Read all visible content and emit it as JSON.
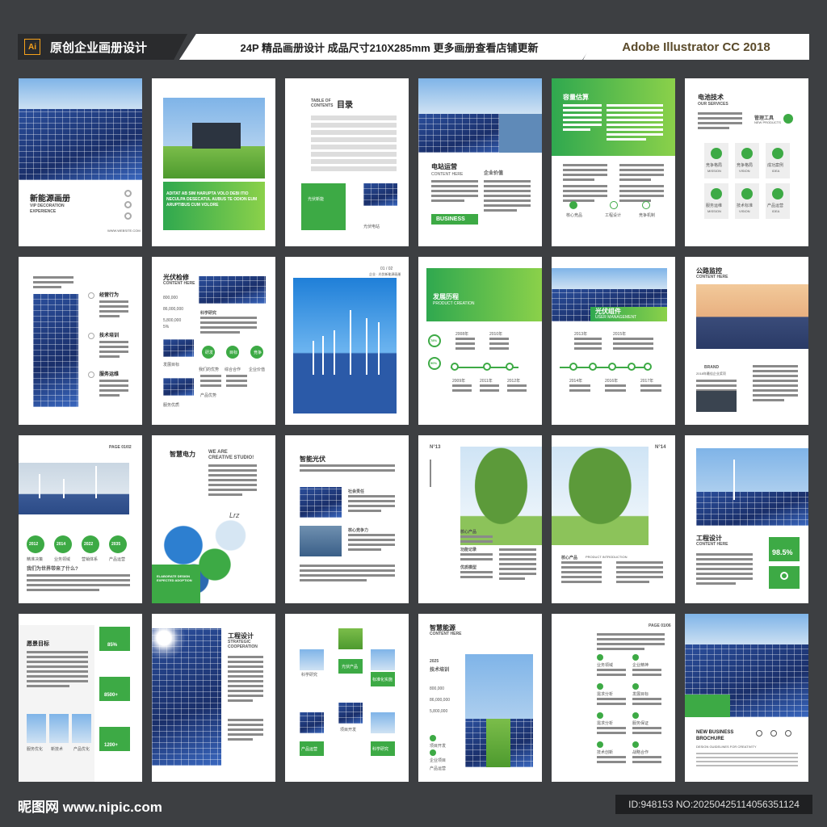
{
  "banner": {
    "badge": "Ai",
    "left": "原创企业画册设计",
    "middle": "24P 精品画册设计  成品尺寸210X285mm  更多画册查看店铺更新",
    "right": "Adobe Illustrator CC 2018"
  },
  "pages": {
    "p1": {
      "title": "新能源画册",
      "sub1": "VIP DECORATION",
      "sub2": "EXPERIENCE",
      "site": "WWW.WEBSITE.COM"
    },
    "p2": {
      "text": "ADITAT AB SIM HARUPTA VOLO DEBI ITIO NECULPA DESECATUL AUBUS TE ODION EUM ARUPTIBUS CUM VOLORE"
    },
    "p3": {
      "toc": "TABLE OF CONTENTS",
      "title": "目录",
      "item": "光伏新能",
      "item2": "光伏电站"
    },
    "p4": {
      "title": "电站运营",
      "sub": "CONTENT HERE",
      "title2": "企业价值",
      "badge": "BUSINESS"
    },
    "p5": {
      "title": "容量估算",
      "i1": "核心竞品",
      "i2": "工程设计",
      "i3": "竞争机制"
    },
    "p6": {
      "title": "电池技术",
      "sub": "OUR SERVICES",
      "tool": "管理工具",
      "tool_sub": "NEW PRODUCTS",
      "g1": "竞争格局",
      "g2": "竞争格局",
      "g3": "成功案例",
      "g4": "服务运维",
      "g5": "技术标准",
      "g6": "产品运营",
      "g1s": "MISSION",
      "g2s": "VISION",
      "g3s": "IDEA"
    },
    "p7": {
      "h1": "经营行为",
      "h2": "技术培训",
      "h3": "服务运维"
    },
    "p8": {
      "title": "光伏检修",
      "sub": "CONTENT HERE",
      "n1": "800,000",
      "n2": "86,000,000",
      "n3": "5,800,000",
      "n4": "5%",
      "l1": "科学研究",
      "c1": "研发",
      "c2": "目标",
      "c3": "竞争",
      "l2": "我们的优势",
      "l3": "综合合作",
      "l4": "企业价值",
      "l5": "服务优质",
      "l6": "产品优势",
      "l7": "发展目标"
    },
    "p9": {
      "num": "01 / 02",
      "sub": "企业 · 光伏新能源画册"
    },
    "p10": {
      "title": "发展历程",
      "sub": "PRODUCT CREATION",
      "pct1": "78%",
      "pct2": "90%",
      "y1": "2008年",
      "y2": "2010年",
      "y3": "2009年",
      "y4": "2011年",
      "y5": "2012年"
    },
    "p11": {
      "title": "光伏组件",
      "sub": "USER MANAGEMENT",
      "y1": "2013年",
      "y2": "2015年",
      "y3": "2014年",
      "y4": "2016年",
      "y5": "2017年"
    },
    "p12": {
      "title": "公路监控",
      "sub": "CONTENT HERE",
      "brand": "BRAND",
      "brand_sub": "2018年最佳企业奖项"
    },
    "p13": {
      "page": "PAGE 01/02",
      "y1": "2012",
      "y2": "2014",
      "y3": "2022",
      "y4": "2035",
      "l1": "精准决策",
      "l2": "业务领域",
      "l3": "营销体系",
      "l4": "产品运营",
      "q": "我们为世界带来了什么?"
    },
    "p14": {
      "title": "智慧电力",
      "we": "WE ARE",
      "cs": "CREATIVE STUDIO!",
      "elab": "ELABORATE DESIGN EXPECTED ADOPTION"
    },
    "p15": {
      "title": "智能光伏",
      "h1": "社会责任",
      "h2": "核心竞争力"
    },
    "p16": {
      "no": "N°13",
      "l1": "核心产品",
      "l2": "功能记录",
      "l3": "优质模型"
    },
    "p17": {
      "no": "N°14",
      "l1": "核心产品",
      "l2": "PRODUCT INTRODUCTION"
    },
    "p18": {
      "title": "工程设计",
      "sub": "CONTENT HERE",
      "pct": "98.5%"
    },
    "p19": {
      "title": "愿景目标",
      "v1": "85%",
      "v2": "8500+",
      "v3": "1200+",
      "l1": "服务优化",
      "l2": "新技术",
      "l3": "产品优化"
    },
    "p20": {
      "title": "工程设计",
      "sub1": "STRATEGIC",
      "sub2": "COOPERATION"
    },
    "p21": {
      "l1": "科学研究",
      "l2": "光伏产品",
      "l3": "标准化实施",
      "l4": "项目开发",
      "l5": "产品运营",
      "l6": "科学研究"
    },
    "p22": {
      "title": "智慧能源",
      "sub": "CONTENT HERE",
      "year": "2025",
      "h": "技术培训",
      "n1": "800,000",
      "n2": "86,000,000",
      "n3": "5,800,000",
      "l1": "项目开发",
      "l2": "企业项目",
      "l3": "产品运营"
    },
    "p23": {
      "page": "PAGE 01/06",
      "l1": "业务领域",
      "l2": "企业精神",
      "l3": "需求分析",
      "l4": "发展目标",
      "l5": "需求分析",
      "l6": "服务保证",
      "l7": "技术创新",
      "l8": "战略合作"
    },
    "p24": {
      "title": "NEW BUSINESS",
      "title2": "BROCHURE",
      "sub": "DESIGN GUIDELINES FOR CREATIVITY"
    }
  },
  "footer": {
    "logo": "昵图网 www.nipic.com",
    "id": "ID:948153 NO:20250425114056351124"
  },
  "colors": {
    "accent": "#3daa45",
    "background": "#3d3f42"
  }
}
